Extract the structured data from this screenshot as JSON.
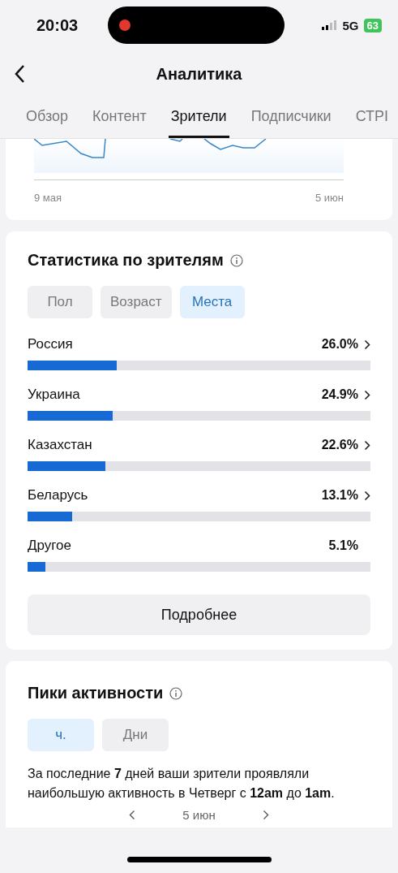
{
  "status_bar": {
    "time": "20:03",
    "network": "5G",
    "battery": "63"
  },
  "header": {
    "title": "Аналитика"
  },
  "tabs": [
    {
      "label": "Обзор",
      "selected": false
    },
    {
      "label": "Контент",
      "selected": false
    },
    {
      "label": "Зрители",
      "selected": true
    },
    {
      "label": "Подписчики",
      "selected": false
    },
    {
      "label": "СТРІ",
      "selected": false
    }
  ],
  "trend_card": {
    "x_start": "9 мая",
    "x_end": "5 июн"
  },
  "viewer_stats": {
    "title": "Статистика по зрителям",
    "filters": [
      {
        "label": "Пол",
        "selected": false
      },
      {
        "label": "Возраст",
        "selected": false
      },
      {
        "label": "Места",
        "selected": true
      }
    ],
    "rows": [
      {
        "name": "Россия",
        "reading": "26.0%",
        "level": 0.26,
        "has_chevron": true
      },
      {
        "name": "Украина",
        "reading": "24.9%",
        "level": 0.249,
        "has_chevron": true
      },
      {
        "name": "Казахстан",
        "reading": "22.6%",
        "level": 0.226,
        "has_chevron": true
      },
      {
        "name": "Беларусь",
        "reading": "13.1%",
        "level": 0.131,
        "has_chevron": true
      },
      {
        "name": "Другое",
        "reading": "5.1%",
        "level": 0.051,
        "has_chevron": false
      }
    ],
    "more_button": "Подробнее"
  },
  "activity": {
    "title": "Пики активности",
    "filters": [
      {
        "label": "ч.",
        "selected": true
      },
      {
        "label": "Дни",
        "selected": false
      }
    ],
    "summary": "За последние **7** дней ваши зрители проявляли наибольшую активность в Четверг с **12am** до **1am**.",
    "date": "5 июн"
  }
}
